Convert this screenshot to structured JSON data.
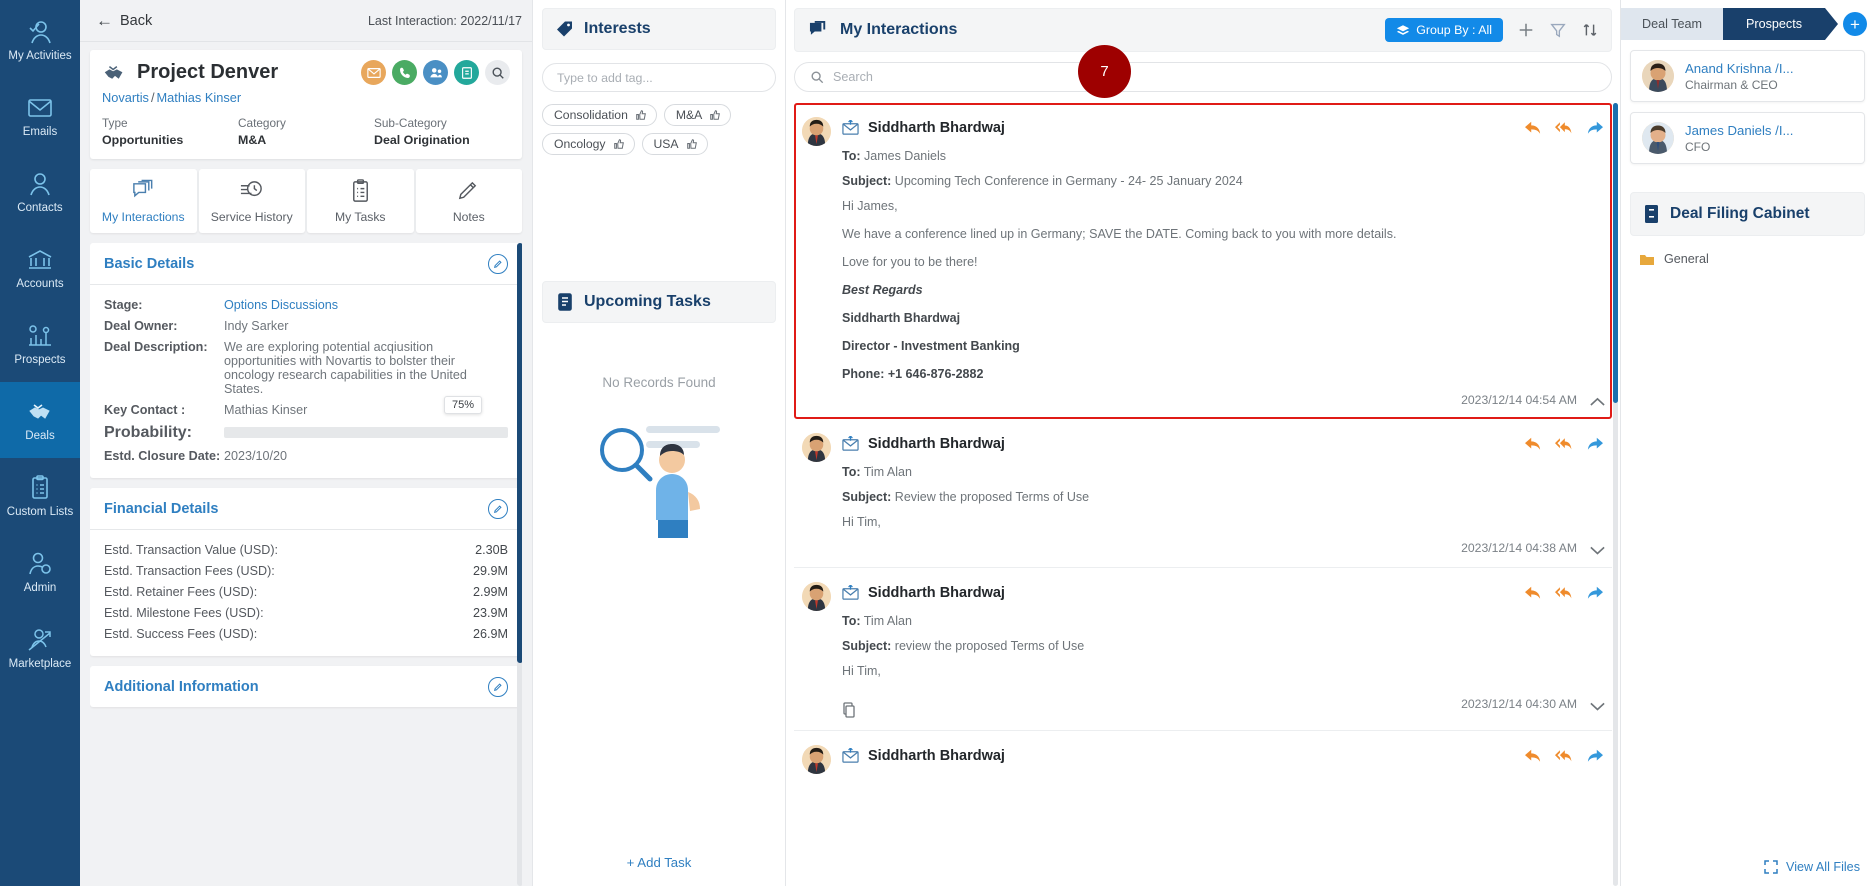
{
  "rail": {
    "items": [
      {
        "label": "My Activities",
        "icon": "user-check-icon",
        "active": false
      },
      {
        "label": "Emails",
        "icon": "envelope-icon",
        "active": false
      },
      {
        "label": "Contacts",
        "icon": "user-icon",
        "active": false
      },
      {
        "label": "Accounts",
        "icon": "bank-icon",
        "active": false
      },
      {
        "label": "Prospects",
        "icon": "chart-gear-icon",
        "active": false
      },
      {
        "label": "Deals",
        "icon": "handshake-icon",
        "active": true
      },
      {
        "label": "Custom Lists",
        "icon": "clipboard-list-icon",
        "active": false
      },
      {
        "label": "Admin",
        "icon": "user-gear-icon",
        "active": false
      },
      {
        "label": "Marketplace",
        "icon": "user-arrow-icon",
        "active": false
      }
    ]
  },
  "deal": {
    "back_label": "Back",
    "last_interaction": "Last Interaction: 2022/11/17",
    "title": "Project Denver",
    "account": "Novartis",
    "separator": "/",
    "contact": "Mathias Kinser",
    "actions": [
      {
        "name": "email-action",
        "icon": "envelope-icon"
      },
      {
        "name": "call-action",
        "icon": "phone-icon"
      },
      {
        "name": "meeting-action",
        "icon": "people-icon"
      },
      {
        "name": "note-action",
        "icon": "edit-icon"
      },
      {
        "name": "search-action",
        "icon": "search-icon"
      }
    ],
    "meta": [
      {
        "key": "Type",
        "value": "Opportunities"
      },
      {
        "key": "Category",
        "value": "M&A"
      },
      {
        "key": "Sub-Category",
        "value": "Deal Origination"
      }
    ],
    "tabs": [
      {
        "label": "My Interactions",
        "icon": "interactions-icon",
        "active": true
      },
      {
        "label": "Service History",
        "icon": "history-clock-icon",
        "active": false
      },
      {
        "label": "My Tasks",
        "icon": "clipboard-icon",
        "active": false
      },
      {
        "label": "Notes",
        "icon": "pencil-note-icon",
        "active": false
      }
    ],
    "basic_details": {
      "title": "Basic Details",
      "rows": [
        {
          "key": "Stage:",
          "value": "Options Discussions",
          "link": true
        },
        {
          "key": "Deal Owner:",
          "value": "Indy Sarker",
          "link": false
        },
        {
          "key": "Deal Description:",
          "value": "We are exploring potential acqiusition opportunities with Novartis to bolster their oncology research capabilities in the United States.",
          "link": false
        },
        {
          "key": "Key Contact :",
          "value": "Mathias Kinser",
          "link": false
        }
      ],
      "probability_label": "Probability:",
      "probability_value": "75%",
      "probability_pct": 75,
      "closure_key": "Estd. Closure Date:",
      "closure_value": "2023/10/20"
    },
    "financial_details": {
      "title": "Financial Details",
      "rows": [
        {
          "key": "Estd. Transaction Value (USD):",
          "value": "2.30B"
        },
        {
          "key": "Estd. Transaction Fees (USD):",
          "value": "29.9M"
        },
        {
          "key": "Estd. Retainer Fees (USD):",
          "value": "2.99M"
        },
        {
          "key": "Estd. Milestone Fees (USD):",
          "value": "23.9M"
        },
        {
          "key": "Estd. Success Fees (USD):",
          "value": "26.9M"
        }
      ]
    },
    "additional_information": {
      "title": "Additional Information"
    }
  },
  "interests": {
    "title": "Interests",
    "input_placeholder": "Type to add tag...",
    "tags": [
      "Consolidation",
      "M&A",
      "Oncology",
      "USA"
    ]
  },
  "tasks": {
    "title": "Upcoming Tasks",
    "empty_text": "No Records Found",
    "add_label": "+ Add Task"
  },
  "interactions": {
    "title": "My Interactions",
    "group_by_label": "Group By : All",
    "search_placeholder": "Search",
    "badge_count": "7",
    "toolbar": [
      {
        "name": "add-interaction-icon",
        "icon": "plus-icon"
      },
      {
        "name": "filter-icon",
        "icon": "funnel-icon"
      },
      {
        "name": "sort-icon",
        "icon": "sort-arrows-icon"
      }
    ],
    "row_actions": [
      {
        "name": "reply-button",
        "icon": "reply-icon"
      },
      {
        "name": "reply-all-button",
        "icon": "reply-all-icon"
      },
      {
        "name": "forward-button",
        "icon": "forward-icon"
      }
    ],
    "messages": [
      {
        "sender": "Siddharth Bhardwaj",
        "to_label": "To:",
        "to": "James Daniels",
        "subject_label": "Subject:",
        "subject": "Upcoming Tech Conference in Germany - 24- 25 January 2024",
        "greeting": "Hi James,",
        "body": "We have a conference lined up in Germany; SAVE the DATE. Coming back to you with more details.",
        "body2": "Love for you to be there!",
        "sign_regards": "Best Regards",
        "sign_name": "Siddharth Bhardwaj",
        "sign_role": "Director - Investment Banking",
        "sign_phone": "Phone: +1 646-876-2882",
        "time": "2023/12/14 04:54 AM",
        "expanded": true,
        "has_attachment": false
      },
      {
        "sender": "Siddharth Bhardwaj",
        "to_label": "To:",
        "to": "Tim Alan",
        "subject_label": "Subject:",
        "subject": "Review the proposed Terms of Use",
        "greeting": "Hi Tim,",
        "time": "2023/12/14 04:38 AM",
        "expanded": false,
        "has_attachment": false
      },
      {
        "sender": "Siddharth Bhardwaj",
        "to_label": "To:",
        "to": "Tim Alan",
        "subject_label": "Subject:",
        "subject": "review the proposed Terms of Use",
        "greeting": "Hi Tim,",
        "time": "2023/12/14 04:30 AM",
        "expanded": false,
        "has_attachment": true
      },
      {
        "sender": "Siddharth Bhardwaj",
        "to_label": "To:",
        "to": "",
        "subject_label": "",
        "subject": "",
        "greeting": "",
        "time": "",
        "expanded": false,
        "has_attachment": false
      }
    ]
  },
  "right": {
    "tab_deal_team": "Deal Team",
    "tab_prospects": "Prospects",
    "people": [
      {
        "name": "Anand Krishna /I...",
        "role": "Chairman & CEO"
      },
      {
        "name": "James Daniels /I...",
        "role": "CFO"
      }
    ],
    "cabinet_title": "Deal Filing Cabinet",
    "folder": "General",
    "view_all": "View All Files"
  },
  "colors": {
    "rail_bg": "#1b4a77",
    "accent_blue": "#2f7fc1",
    "group_by_blue": "#128ae8",
    "badge_red": "#9e0000",
    "selected_border": "#e01b16",
    "navy": "#19406b"
  }
}
